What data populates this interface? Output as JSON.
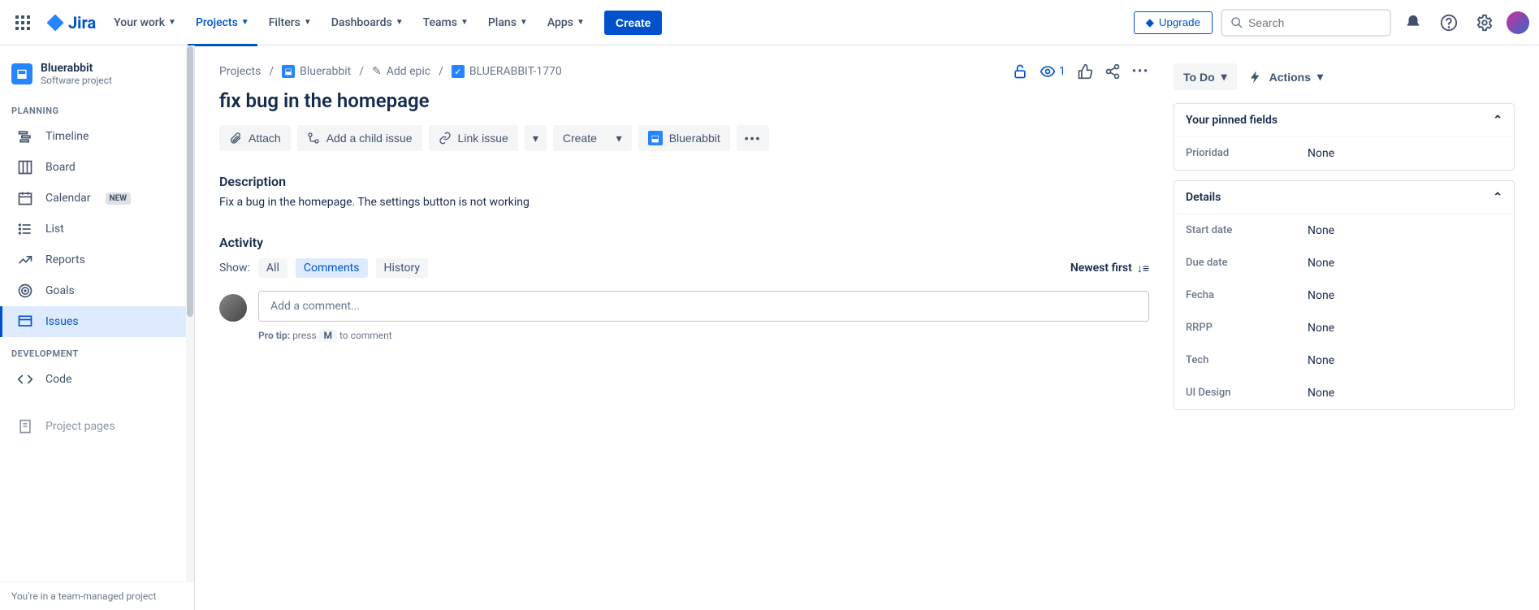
{
  "brand": "Jira",
  "nav": {
    "your_work": "Your work",
    "projects": "Projects",
    "filters": "Filters",
    "dashboards": "Dashboards",
    "teams": "Teams",
    "plans": "Plans",
    "apps": "Apps",
    "create": "Create",
    "upgrade": "Upgrade",
    "search_placeholder": "Search"
  },
  "sidebar": {
    "project_name": "Bluerabbit",
    "project_sub": "Software project",
    "sections": {
      "planning": "PLANNING",
      "development": "DEVELOPMENT"
    },
    "items": {
      "timeline": "Timeline",
      "board": "Board",
      "calendar": "Calendar",
      "calendar_badge": "NEW",
      "list": "List",
      "reports": "Reports",
      "goals": "Goals",
      "issues": "Issues",
      "code": "Code",
      "project_pages": "Project pages"
    },
    "footer": "You're in a team-managed project"
  },
  "breadcrumb": {
    "projects": "Projects",
    "project": "Bluerabbit",
    "add_epic": "Add epic",
    "issue_key": "BLUERABBIT-1770"
  },
  "watch_count": "1",
  "issue": {
    "title": "fix bug in the homepage",
    "toolbar": {
      "attach": "Attach",
      "add_child": "Add a child issue",
      "link": "Link issue",
      "create": "Create",
      "project_chip": "Bluerabbit"
    },
    "description_heading": "Description",
    "description_text": "Fix a bug in the homepage. The settings button is not working",
    "activity_heading": "Activity",
    "show_label": "Show:",
    "tabs": {
      "all": "All",
      "comments": "Comments",
      "history": "History"
    },
    "sort": "Newest first",
    "comment_placeholder": "Add a comment...",
    "protip_label": "Pro tip:",
    "protip_press": "press",
    "protip_key": "M",
    "protip_tail": "to comment"
  },
  "status": {
    "label": "To Do",
    "actions": "Actions"
  },
  "pinned": {
    "heading": "Your pinned fields",
    "rows": [
      {
        "label": "Prioridad",
        "value": "None"
      }
    ]
  },
  "details": {
    "heading": "Details",
    "rows": [
      {
        "label": "Start date",
        "value": "None"
      },
      {
        "label": "Due date",
        "value": "None"
      },
      {
        "label": "Fecha",
        "value": "None"
      },
      {
        "label": "RRPP",
        "value": "None"
      },
      {
        "label": "Tech",
        "value": "None"
      },
      {
        "label": "UI Design",
        "value": "None"
      }
    ]
  }
}
